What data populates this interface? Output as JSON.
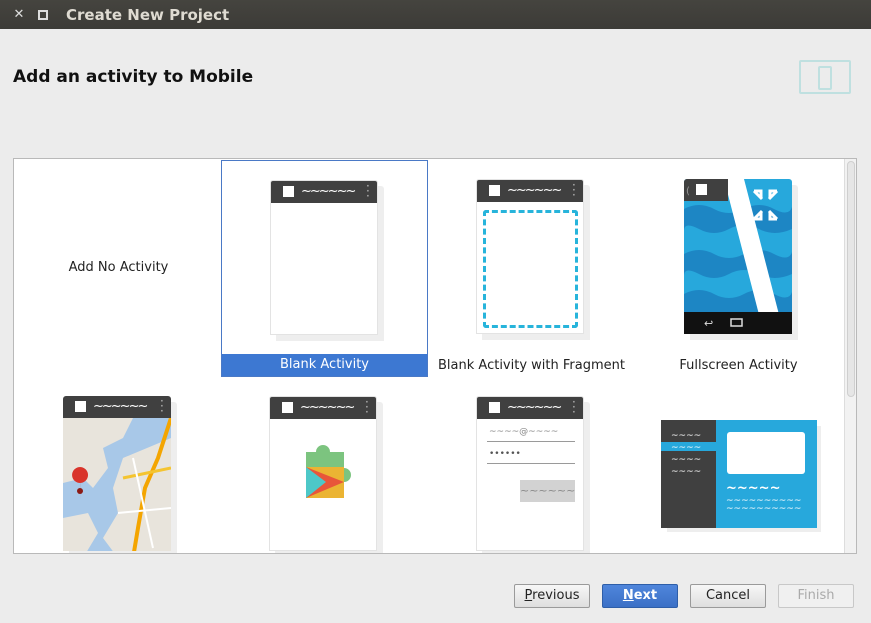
{
  "window": {
    "title": "Create New Project",
    "close_symbol": "✕"
  },
  "header": {
    "title": "Add an activity to Mobile"
  },
  "tiles": [
    {
      "label": "Add No Activity"
    },
    {
      "label": "Blank Activity"
    },
    {
      "label": "Blank Activity with Fragment"
    },
    {
      "label": "Fullscreen Activity"
    },
    {
      "label": ""
    },
    {
      "label": ""
    },
    {
      "label": ""
    },
    {
      "label": ""
    }
  ],
  "selected_tile": "Blank Activity",
  "phone": {
    "wave": "~~~~~~",
    "login_email_text": "~~~~@~~~~",
    "login_password_text": "••••••",
    "login_button_text": "~~~~~~"
  },
  "buttons": {
    "previous": {
      "prefix": "",
      "mnemonic": "P",
      "rest": "revious"
    },
    "next": {
      "prefix": "",
      "mnemonic": "N",
      "rest": "ext"
    },
    "cancel": "Cancel",
    "finish": "Finish"
  },
  "colors": {
    "accent": "#3d78d2",
    "teal": "#27b4db",
    "bar": "#404040"
  }
}
